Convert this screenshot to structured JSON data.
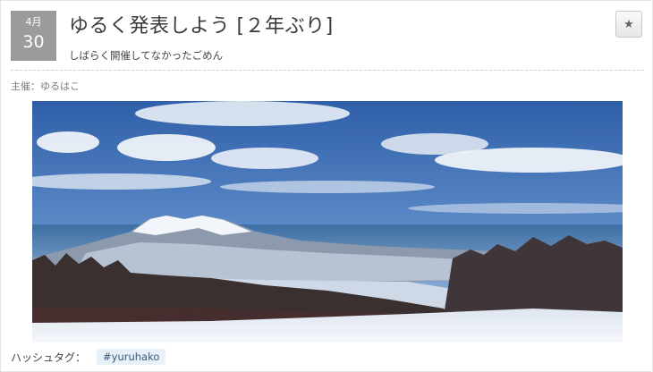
{
  "event": {
    "date": {
      "month": "4月",
      "day": "30"
    },
    "title": "ゆるく発表しよう [２年ぶり]",
    "subtitle": "しばらく開催してなかったごめん",
    "organizer": "主催：ゆるはこ",
    "hashtag_label": "ハッシュタグ：",
    "hashtag": "#yuruhako"
  },
  "icons": {
    "favorite": "star-icon"
  },
  "colors": {
    "date_badge": "#9b9b9b",
    "hashtag_bg": "#e8f0f8",
    "hashtag_text": "#3d5a80"
  }
}
